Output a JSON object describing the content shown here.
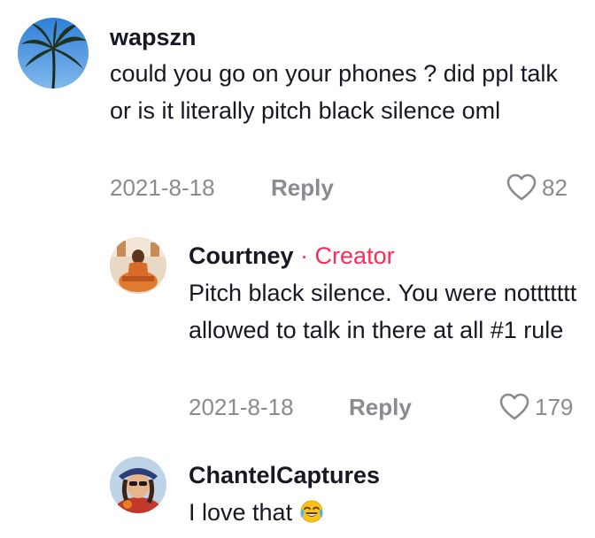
{
  "comments": [
    {
      "username": "wapszn",
      "text": "could you go on your phones ? did ppl talk or is it literally pitch black silence oml",
      "date": "2021-8-18",
      "reply_label": "Reply",
      "likes": "82",
      "avatar_icon": "palm-tree-avatar"
    },
    {
      "username": "Courtney",
      "separator": "·",
      "badge": "Creator",
      "text": "Pitch black silence. You were nottttttt allowed to talk in there at all #1 rule",
      "date": "2021-8-18",
      "reply_label": "Reply",
      "likes": "179",
      "avatar_icon": "creator-avatar"
    },
    {
      "username": "ChantelCaptures",
      "text": "I love that",
      "emoji": "face-with-tears-of-joy",
      "avatar_icon": "user-avatar"
    }
  ],
  "colors": {
    "text": "#161823",
    "muted": "#8a8b91",
    "creator": "#fe2c55"
  }
}
